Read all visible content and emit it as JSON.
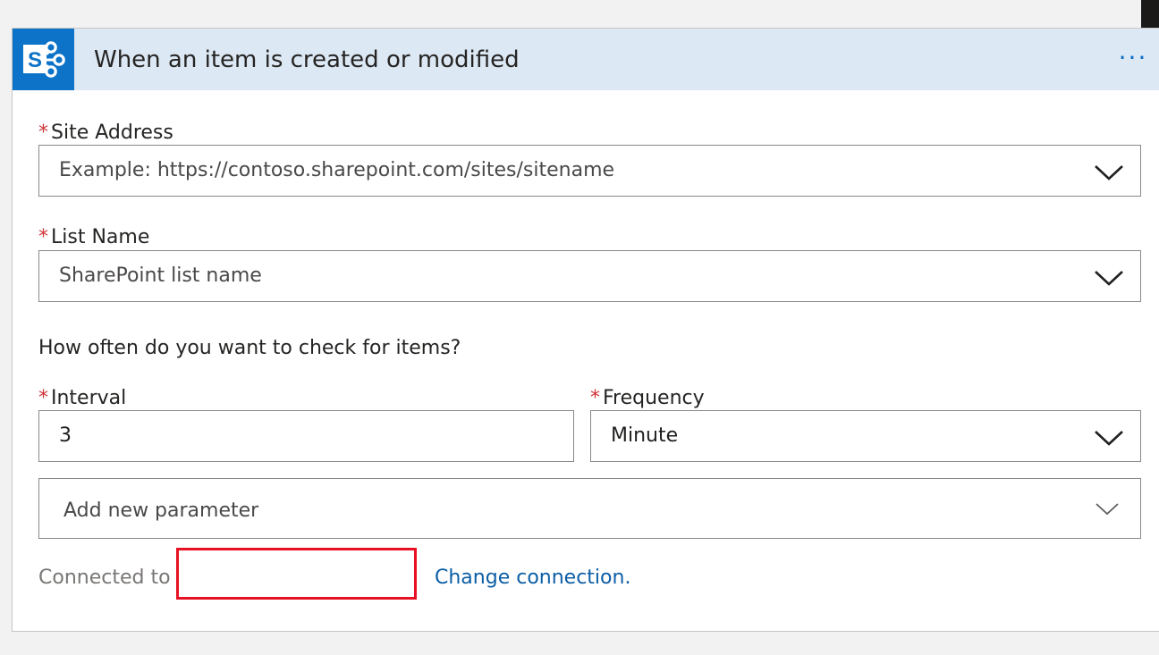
{
  "trigger": {
    "title": "When an item is created or modified",
    "icon": "sharepoint-icon",
    "more_label": "···"
  },
  "fields": {
    "required_marker": "*",
    "site_address": {
      "label": "Site Address",
      "placeholder": "Example: https://contoso.sharepoint.com/sites/sitename"
    },
    "list_name": {
      "label": "List Name",
      "placeholder": "SharePoint list name"
    },
    "schedule_question": "How often do you want to check for items?",
    "interval": {
      "label": "Interval",
      "value": "3"
    },
    "frequency": {
      "label": "Frequency",
      "value": "Minute"
    },
    "add_parameter": {
      "placeholder": "Add new parameter"
    }
  },
  "connection": {
    "label": "Connected to",
    "change_label": "Change connection."
  },
  "colors": {
    "header_bg": "#dce8f4",
    "sharepoint_blue": "#0d73c8",
    "required_red": "#d13438",
    "link_blue": "#0c5ea6",
    "highlight_red": "#e81123"
  }
}
